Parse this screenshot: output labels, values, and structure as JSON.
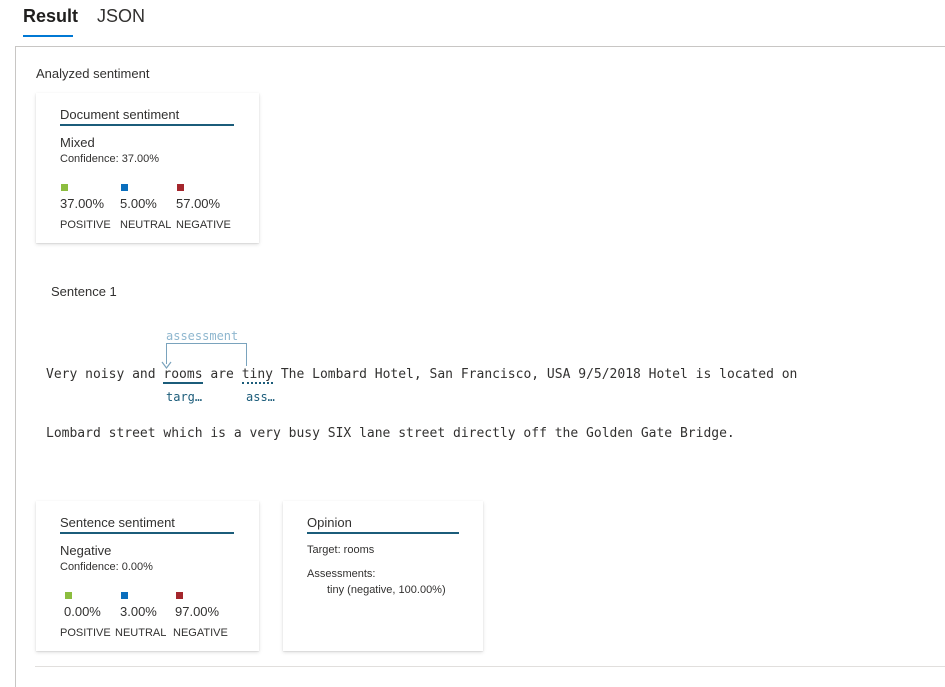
{
  "tabs": [
    {
      "label": "Result",
      "active": true
    },
    {
      "label": "JSON",
      "active": false
    }
  ],
  "section_title": "Analyzed sentiment",
  "document_card": {
    "title": "Document sentiment",
    "label": "Mixed",
    "confidence": "Confidence: 37.00%",
    "scores": [
      {
        "value": "37.00%",
        "label": "POSITIVE",
        "color": "#8cbd3f"
      },
      {
        "value": "5.00%",
        "label": "NEUTRAL",
        "color": "#0a6ebd"
      },
      {
        "value": "57.00%",
        "label": "NEGATIVE",
        "color": "#a4262c"
      }
    ]
  },
  "sentence": {
    "title": "Sentence 1",
    "relation_label": "assessment",
    "line1": {
      "pre": "Very noisy and ",
      "target": "rooms",
      "mid": " are ",
      "assessment": "tiny",
      "post": " The Lombard Hotel, San Francisco, USA 9/5/2018 Hotel is located on"
    },
    "line2": "Lombard street which is a very busy SIX lane street directly off the Golden Gate Bridge.",
    "target_tag": "targ…",
    "assessment_tag": "ass…"
  },
  "sentence_card": {
    "title": "Sentence sentiment",
    "label": "Negative",
    "confidence": "Confidence: 0.00%",
    "scores": [
      {
        "value": "0.00%",
        "label": "POSITIVE",
        "color": "#8cbd3f"
      },
      {
        "value": "3.00%",
        "label": "NEUTRAL",
        "color": "#0a6ebd"
      },
      {
        "value": "97.00%",
        "label": "NEGATIVE",
        "color": "#a4262c"
      }
    ]
  },
  "opinion_card": {
    "title": "Opinion",
    "target": "Target: rooms",
    "assessments_heading": "Assessments:",
    "assessment_item": "tiny (negative, 100.00%)"
  }
}
